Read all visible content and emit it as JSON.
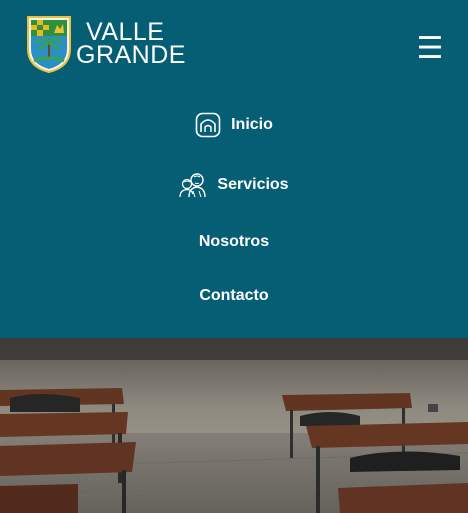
{
  "brand": {
    "line1": "VALLE",
    "line2": "GRANDE",
    "logo_icon": "school-crest-icon"
  },
  "header": {
    "background": "#065e74",
    "menu_icon": "hamburger-menu-icon",
    "menu_glyph": "☰"
  },
  "nav": {
    "items": [
      {
        "label": "Inicio",
        "icon": "home-icon"
      },
      {
        "label": "Servicios",
        "icon": "services-people-icon"
      },
      {
        "label": "Nosotros"
      },
      {
        "label": "Contacto"
      }
    ]
  },
  "hero": {
    "image": "classroom-desks-photo"
  }
}
